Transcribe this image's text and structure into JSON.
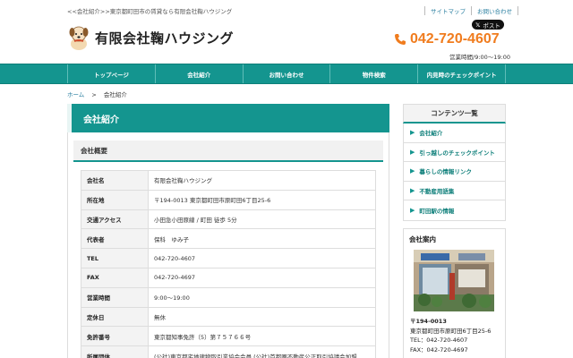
{
  "top": {
    "breadcrumb_text": "<<会社紹介>>東京都町田市の賃貸なら有限会社鞠ハウジング",
    "links": [
      "サイトマップ",
      "お問い合わせ"
    ],
    "x_post_label": "ポスト"
  },
  "header": {
    "company_name": "有限会社鞠ハウジング",
    "phone": "042-720-4607",
    "hours": "営業時間/9:00～19:00",
    "accent_color": "#14958f",
    "phone_color": "#f07c1e"
  },
  "nav": {
    "items": [
      "トップページ",
      "会社紹介",
      "お問い合わせ",
      "物件検索",
      "内見時のチェックポイント"
    ]
  },
  "breadcrumb": {
    "home": "ホーム",
    "separator": ">",
    "current": "会社紹介"
  },
  "main": {
    "title": "会社紹介",
    "section_title": "会社概要",
    "rows": [
      {
        "key": "会社名",
        "value": "有限会社鞠ハウジング"
      },
      {
        "key": "所在地",
        "value": "〒194-0013 東京都町田市原町田6丁目25-6"
      },
      {
        "key": "交通アクセス",
        "value": "小田急小田原線 / 町田 徒歩 5分"
      },
      {
        "key": "代表者",
        "value": "保科　ゆみ子"
      },
      {
        "key": "TEL",
        "value": "042-720-4607"
      },
      {
        "key": "FAX",
        "value": "042-720-4697"
      },
      {
        "key": "営業時間",
        "value": "9:00～19:00"
      },
      {
        "key": "定休日",
        "value": "無休"
      },
      {
        "key": "免許番号",
        "value": "東京都知事免許（5）第７５７６６号"
      },
      {
        "key": "所属団体",
        "value": "(公社)東京都宅地建物取引業協会会員 (公社)首都圏不動産公正取引協議会加盟"
      }
    ]
  },
  "sidebar": {
    "title": "コンテンツ一覧",
    "items": [
      "会社紹介",
      "引っ越しのチェックポイント",
      "暮らしの情報リンク",
      "不動産用語集",
      "町田駅の情報"
    ],
    "company_head": "会社案内",
    "zip": "〒194-0013",
    "address": "東京都町田市原町田6丁目25-6",
    "tel": "TEL：042-720-4607",
    "fax": "FAX：042-720-4697"
  }
}
